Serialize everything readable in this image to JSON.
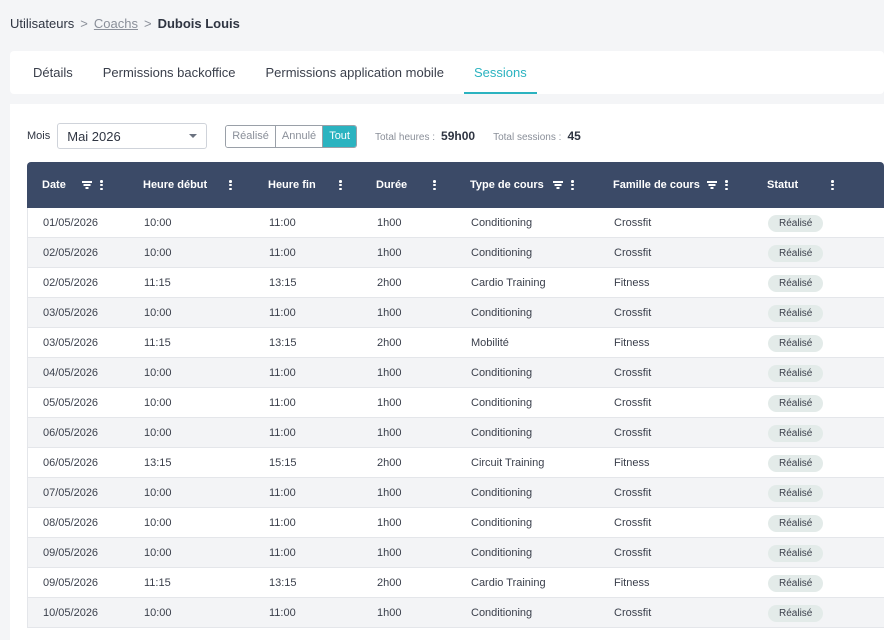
{
  "breadcrumb": {
    "root": "Utilisateurs",
    "separator": ">",
    "link": "Coachs",
    "current": "Dubois Louis"
  },
  "tabs": [
    {
      "label": "Détails",
      "active": false
    },
    {
      "label": "Permissions backoffice",
      "active": false
    },
    {
      "label": "Permissions application mobile",
      "active": false
    },
    {
      "label": "Sessions",
      "active": true
    }
  ],
  "filters": {
    "month_label": "Mois",
    "month_value": "Mai 2026",
    "status_options": [
      "Réalisé",
      "Annulé",
      "Tout"
    ],
    "status_selected": "Tout",
    "total_hours_label": "Total heures :",
    "total_hours_value": "59h00",
    "total_sessions_label": "Total sessions :",
    "total_sessions_value": "45"
  },
  "table": {
    "columns": [
      "Date",
      "Heure début",
      "Heure fin",
      "Durée",
      "Type de cours",
      "Famille de cours",
      "Statut"
    ],
    "rows": [
      [
        "01/05/2026",
        "10:00",
        "11:00",
        "1h00",
        "Conditioning",
        "Crossfit",
        "Réalisé"
      ],
      [
        "02/05/2026",
        "10:00",
        "11:00",
        "1h00",
        "Conditioning",
        "Crossfit",
        "Réalisé"
      ],
      [
        "02/05/2026",
        "11:15",
        "13:15",
        "2h00",
        "Cardio Training",
        "Fitness",
        "Réalisé"
      ],
      [
        "03/05/2026",
        "10:00",
        "11:00",
        "1h00",
        "Conditioning",
        "Crossfit",
        "Réalisé"
      ],
      [
        "03/05/2026",
        "11:15",
        "13:15",
        "2h00",
        "Mobilité",
        "Fitness",
        "Réalisé"
      ],
      [
        "04/05/2026",
        "10:00",
        "11:00",
        "1h00",
        "Conditioning",
        "Crossfit",
        "Réalisé"
      ],
      [
        "05/05/2026",
        "10:00",
        "11:00",
        "1h00",
        "Conditioning",
        "Crossfit",
        "Réalisé"
      ],
      [
        "06/05/2026",
        "10:00",
        "11:00",
        "1h00",
        "Conditioning",
        "Crossfit",
        "Réalisé"
      ],
      [
        "06/05/2026",
        "13:15",
        "15:15",
        "2h00",
        "Circuit Training",
        "Fitness",
        "Réalisé"
      ],
      [
        "07/05/2026",
        "10:00",
        "11:00",
        "1h00",
        "Conditioning",
        "Crossfit",
        "Réalisé"
      ],
      [
        "08/05/2026",
        "10:00",
        "11:00",
        "1h00",
        "Conditioning",
        "Crossfit",
        "Réalisé"
      ],
      [
        "09/05/2026",
        "10:00",
        "11:00",
        "1h00",
        "Conditioning",
        "Crossfit",
        "Réalisé"
      ],
      [
        "09/05/2026",
        "11:15",
        "13:15",
        "2h00",
        "Cardio Training",
        "Fitness",
        "Réalisé"
      ],
      [
        "10/05/2026",
        "10:00",
        "11:00",
        "1h00",
        "Conditioning",
        "Crossfit",
        "Réalisé"
      ]
    ]
  },
  "colors": {
    "accent": "#2bb3c0",
    "header_bg": "#3b4a67",
    "badge_bg": "#e3ebe9"
  }
}
